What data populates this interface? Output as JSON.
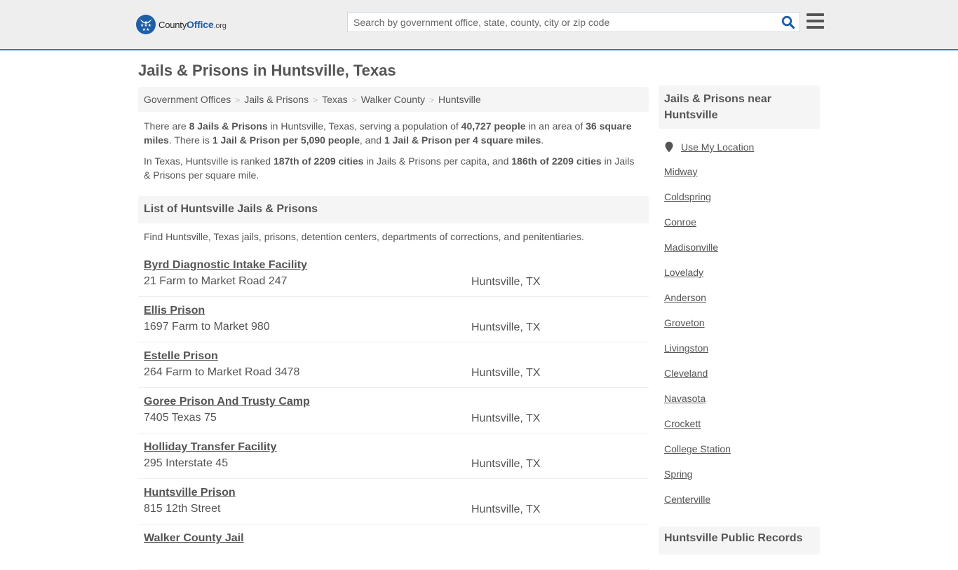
{
  "header": {
    "logo": {
      "name_prefix": "County",
      "name_office": "Office",
      "name_suffix": ".org",
      "icon": "eagle-stars-badge-icon"
    },
    "search": {
      "placeholder": "Search by government office, state, county, city or zip code",
      "value": "",
      "icon": "search-icon"
    },
    "menu_icon": "hamburger-menu-icon",
    "accent_color": "#337ab7"
  },
  "page": {
    "title": "Jails & Prisons in Huntsville, Texas"
  },
  "breadcrumb": [
    {
      "label": "Government Offices"
    },
    {
      "label": "Jails & Prisons"
    },
    {
      "label": "Texas"
    },
    {
      "label": "Walker County"
    },
    {
      "label": "Huntsville"
    }
  ],
  "intro": {
    "p1": [
      {
        "t": "There are ",
        "b": false
      },
      {
        "t": "8 Jails & Prisons",
        "b": true
      },
      {
        "t": " in Huntsville, Texas, serving a population of ",
        "b": false
      },
      {
        "t": "40,727 people",
        "b": true
      },
      {
        "t": " in an area of ",
        "b": false
      },
      {
        "t": "36 square miles",
        "b": true
      },
      {
        "t": ". There is ",
        "b": false
      },
      {
        "t": "1 Jail & Prison per 5,090 people",
        "b": true
      },
      {
        "t": ", and ",
        "b": false
      },
      {
        "t": "1 Jail & Prison per 4 square miles",
        "b": true
      },
      {
        "t": ".",
        "b": false
      }
    ],
    "p2": [
      {
        "t": "In Texas, Huntsville is ranked ",
        "b": false
      },
      {
        "t": "187th of 2209 cities",
        "b": true
      },
      {
        "t": " in Jails & Prisons per capita, and ",
        "b": false
      },
      {
        "t": "186th of 2209 cities",
        "b": true
      },
      {
        "t": " in Jails & Prisons per square mile.",
        "b": false
      }
    ]
  },
  "list": {
    "heading": "List of Huntsville Jails & Prisons",
    "description": "Find Huntsville, Texas jails, prisons, detention centers, departments of corrections, and penitentiaries.",
    "facilities": [
      {
        "name": "Byrd Diagnostic Intake Facility",
        "address": "21 Farm to Market Road 247",
        "city": "Huntsville, TX"
      },
      {
        "name": "Ellis Prison",
        "address": "1697 Farm to Market 980",
        "city": "Huntsville, TX"
      },
      {
        "name": "Estelle Prison",
        "address": "264 Farm to Market Road 3478",
        "city": "Huntsville, TX"
      },
      {
        "name": "Goree Prison And Trusty Camp",
        "address": "7405 Texas 75",
        "city": "Huntsville, TX"
      },
      {
        "name": "Holliday Transfer Facility",
        "address": "295 Interstate 45",
        "city": "Huntsville, TX"
      },
      {
        "name": "Huntsville Prison",
        "address": "815 12th Street",
        "city": "Huntsville, TX"
      },
      {
        "name": "Walker County Jail",
        "address": "",
        "city": ""
      }
    ]
  },
  "sidebar": {
    "heading": "Jails & Prisons near Huntsville",
    "use_location": "Use My Location",
    "location_icon": "map-pin-icon",
    "nearby": [
      "Midway",
      "Coldspring",
      "Conroe",
      "Madisonville",
      "Lovelady",
      "Anderson",
      "Groveton",
      "Livingston",
      "Cleveland",
      "Navasota",
      "Crockett",
      "College Station",
      "Spring",
      "Centerville"
    ],
    "heading2": "Huntsville Public Records"
  }
}
